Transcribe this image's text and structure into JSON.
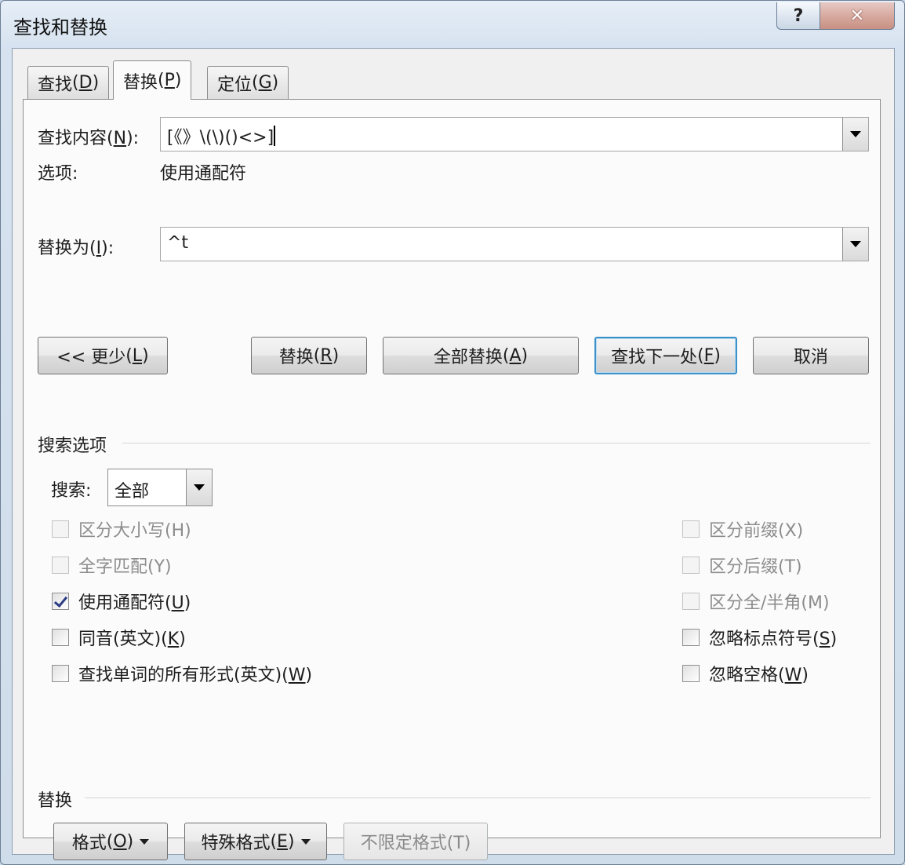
{
  "window": {
    "title": "查找和替换",
    "help_label": "?",
    "close_label": "✕"
  },
  "tabs": [
    {
      "label": "查找",
      "key": "D",
      "active": false
    },
    {
      "label": "替换",
      "key": "P",
      "active": true
    },
    {
      "label": "定位",
      "key": "G",
      "active": false
    }
  ],
  "find": {
    "label": "查找内容",
    "key": "N",
    "value": "[《》\\(\\)()<>]"
  },
  "options": {
    "label": "选项:",
    "value": "使用通配符"
  },
  "replace": {
    "label": "替换为",
    "key": "I",
    "value": "^t"
  },
  "buttons": {
    "less": {
      "label": "<< 更少",
      "key": "L"
    },
    "replace": {
      "label": "替换",
      "key": "R"
    },
    "replace_all": {
      "label": "全部替换",
      "key": "A"
    },
    "find_next": {
      "label": "查找下一处",
      "key": "F"
    },
    "cancel": {
      "label": "取消"
    }
  },
  "search_options": {
    "heading": "搜索选项",
    "search_label": "搜索",
    "search_key": "",
    "search_value": "全部",
    "left": [
      {
        "label": "区分大小写(H)",
        "checked": false,
        "disabled": true
      },
      {
        "label": "全字匹配(Y)",
        "checked": false,
        "disabled": true
      },
      {
        "label": "使用通配符",
        "key": "U",
        "checked": true,
        "disabled": false
      },
      {
        "label": "同音(英文)",
        "key": "K",
        "checked": false,
        "disabled": false
      },
      {
        "label": "查找单词的所有形式(英文)",
        "key": "W",
        "checked": false,
        "disabled": false
      }
    ],
    "right": [
      {
        "label": "区分前缀(X)",
        "checked": false,
        "disabled": true
      },
      {
        "label": "区分后缀(T)",
        "checked": false,
        "disabled": true
      },
      {
        "label": "区分全/半角(M)",
        "checked": false,
        "disabled": true
      },
      {
        "label": "忽略标点符号",
        "key": "S",
        "checked": false,
        "disabled": false
      },
      {
        "label": "忽略空格",
        "key": "W",
        "checked": false,
        "disabled": false
      }
    ]
  },
  "replace_section": {
    "heading": "替换",
    "format": {
      "label": "格式",
      "key": "O"
    },
    "special": {
      "label": "特殊格式",
      "key": "E"
    },
    "no_format": {
      "label": "不限定格式(T)"
    }
  },
  "colors": {
    "default_button_border": "#3d91c9",
    "checkmark": "#2a3b84",
    "disabled_text": "#8d8d8d"
  }
}
